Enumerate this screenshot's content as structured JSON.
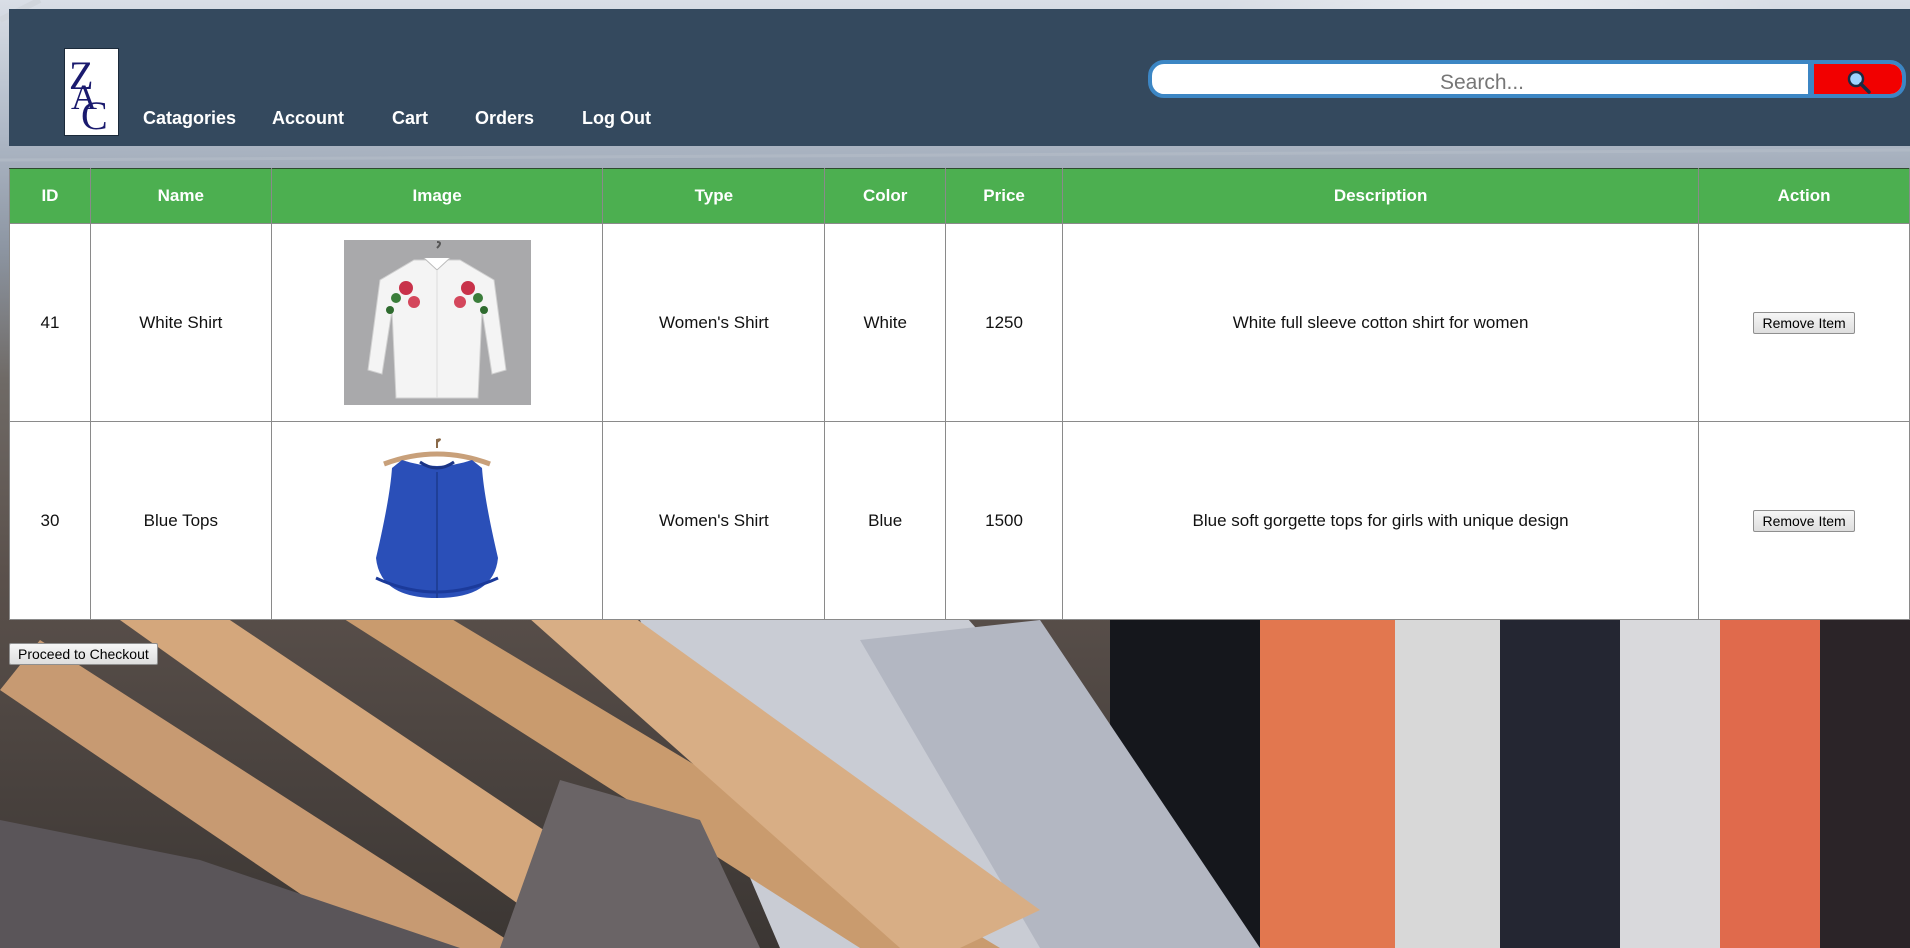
{
  "header": {
    "logo_alt": "ZAC",
    "nav": [
      {
        "label": "Catagories"
      },
      {
        "label": "Account"
      },
      {
        "label": "Cart"
      },
      {
        "label": "Orders"
      },
      {
        "label": "Log Out"
      }
    ],
    "search": {
      "placeholder": "Search...",
      "value": "",
      "button_icon": "search-icon",
      "button_color": "#f20000"
    }
  },
  "cart": {
    "columns": [
      "ID",
      "Name",
      "Image",
      "Type",
      "Color",
      "Price",
      "Description",
      "Action"
    ],
    "rows": [
      {
        "id": "41",
        "name": "White Shirt",
        "image": "white-embroidered-shirt",
        "type": "Women's Shirt",
        "color": "White",
        "price": "1250",
        "description": "White full sleeve cotton shirt for women",
        "action": "Remove Item"
      },
      {
        "id": "30",
        "name": "Blue Tops",
        "image": "blue-sleeveless-top",
        "type": "Women's Shirt",
        "color": "Blue",
        "price": "1500",
        "description": "Blue soft gorgette tops for girls with unique design",
        "action": "Remove Item"
      }
    ]
  },
  "checkout_label": "Proceed to Checkout",
  "colors": {
    "header_bg": "#34495e",
    "table_header_bg": "#4caf50",
    "search_border": "#3c86c4"
  }
}
